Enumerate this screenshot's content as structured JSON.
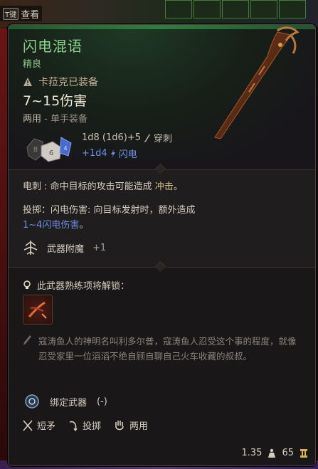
{
  "overlay": {
    "key_hint": "T键",
    "label": "查看"
  },
  "item": {
    "name": "闪电混语",
    "rarity": "精良",
    "equipped_by": "卡菈克已装备",
    "damage": "7~15伤害",
    "handedness": "两用",
    "hand_note": "单手装备",
    "damage_main": "1d8 (1d6)+5",
    "damage_main_type": "穿刺",
    "damage_extra": "+1d4",
    "damage_extra_type": "闪电"
  },
  "abilities": {
    "shock_label": "电刺 : 命中目标的攻击可能造成",
    "shock_effect": "冲击",
    "shock_end": "。",
    "throw_line1": "投掷：闪电伤害: 向目标发射时，额外造成",
    "throw_damage": "1~4闪电伤害",
    "throw_end": "。",
    "enchant_label": "武器附魔",
    "enchant_value": "+1"
  },
  "proficiency": {
    "unlock_text": "此武器熟练项将解锁："
  },
  "lore": "寇涛鱼人的神明名叫利多尔普，寇涛鱼人忍受这个事的程度，就像忍受家里一位滔滔不绝自顾自聊自己火车收藏的叔叔。",
  "traits": {
    "bound": "绑定武器",
    "bound_value": "(-)",
    "props": [
      {
        "icon": "spear-icon",
        "label": "短矛"
      },
      {
        "icon": "throw-icon",
        "label": "投掷"
      },
      {
        "icon": "hand-icon",
        "label": "两用"
      }
    ]
  },
  "footer": {
    "weight": "1.35",
    "value": "65"
  },
  "colors": {
    "title": "#8cd18a",
    "lightning": "#6f8fe0",
    "highlight": "#d8c48a"
  }
}
